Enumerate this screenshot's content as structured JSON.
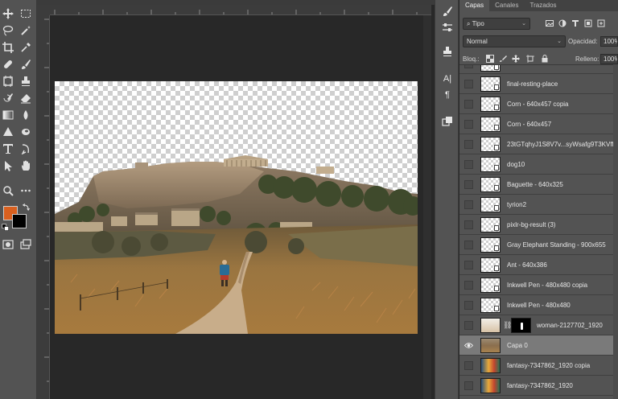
{
  "tools_panel": {
    "foreground_color": "#d9601f",
    "background_color": "#000000",
    "icons": [
      "move-icon",
      "marquee-icon",
      "lasso-icon",
      "magic-wand-icon",
      "crop-icon",
      "eyedropper-icon",
      "healing-brush-icon",
      "brush-icon",
      "frame-icon",
      "clone-stamp-icon",
      "history-brush-icon",
      "eraser-icon",
      "gradient-icon",
      "blur-icon",
      "dodge-icon",
      "pen-icon",
      "type-icon",
      "path-select-icon",
      "shape-icon",
      "hand-icon",
      "zoom-icon",
      "more-tools-icon"
    ]
  },
  "layers_panel": {
    "tabs": [
      "Capas",
      "Canales",
      "Trazados"
    ],
    "active_tab": "Capas",
    "filter_kind": "Tipo",
    "blend_mode": "Normal",
    "opacity_label": "Opacidad:",
    "opacity_value": "100%",
    "lock_label": "Bloq.:",
    "fill_label": "Relleno:",
    "fill_value": "100%",
    "layers": [
      {
        "name": "",
        "thumb": "checker",
        "visible": false
      },
      {
        "name": "final-resting-place",
        "thumb": "checker",
        "visible": false
      },
      {
        "name": "Corn - 640x457 copia",
        "thumb": "checker",
        "visible": false
      },
      {
        "name": "Corn - 640x457",
        "thumb": "checker",
        "visible": false
      },
      {
        "name": "23tGTqhyJ1S8V7v...syWsafg9T3KVff",
        "thumb": "checker",
        "visible": false
      },
      {
        "name": "dog10",
        "thumb": "checker",
        "visible": false
      },
      {
        "name": "Baguette - 640x325",
        "thumb": "checker",
        "visible": false
      },
      {
        "name": "tyrion2",
        "thumb": "checker",
        "visible": false
      },
      {
        "name": "pixlr-bg-result (3)",
        "thumb": "checker",
        "visible": false
      },
      {
        "name": "Gray Elephant Standing - 900x655",
        "thumb": "checker",
        "visible": false
      },
      {
        "name": "Ant - 640x386",
        "thumb": "checker",
        "visible": false
      },
      {
        "name": "Inkwell Pen - 480x480 copia",
        "thumb": "checker",
        "visible": false
      },
      {
        "name": "Inkwell Pen - 480x480",
        "thumb": "checker",
        "visible": false
      },
      {
        "name": "woman-2127702_1920",
        "thumb": "woman",
        "visible": false,
        "mask": true
      },
      {
        "name": "Capa 0",
        "thumb": "photo",
        "visible": true,
        "selected": true
      },
      {
        "name": "fantasy-7347862_1920 copia",
        "thumb": "fantasy",
        "visible": false
      },
      {
        "name": "fantasy-7347862_1920",
        "thumb": "fantasy",
        "visible": false
      }
    ]
  },
  "panel_icons": [
    "brush-settings-icon",
    "adjust-icon",
    "clone-source-icon",
    "character-icon",
    "paragraph-icon",
    "layer-comps-icon"
  ],
  "character_glyph": "A|",
  "paragraph_glyph": "¶"
}
